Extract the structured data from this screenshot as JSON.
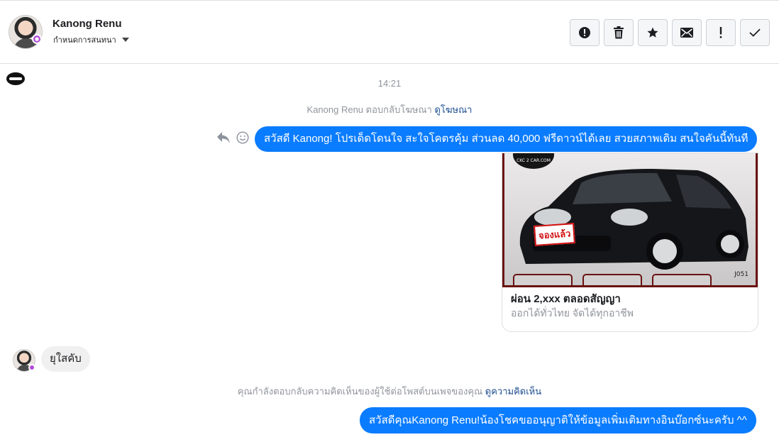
{
  "header": {
    "contact_name": "Kanong Renu",
    "assign_label": "กำหนดการสนทนา",
    "actions": [
      {
        "name": "spam-button",
        "icon": "exclamation-circle-icon"
      },
      {
        "name": "delete-button",
        "icon": "trash-icon"
      },
      {
        "name": "star-button",
        "icon": "star-icon"
      },
      {
        "name": "mark-unread-button",
        "icon": "envelope-icon"
      },
      {
        "name": "follow-up-button",
        "icon": "exclamation-icon"
      },
      {
        "name": "mark-done-button",
        "icon": "check-icon"
      }
    ]
  },
  "thread": {
    "timestamp": "14:21",
    "ad_reply_notice": {
      "text": "Kanong Renu ตอบกลับโฆษณา",
      "link": "ดูโฆษณา"
    },
    "outgoing_1": "สวัสดี Kanong! โปรเด็ดโดนใจ สะใจโคตรคุ้ม ส่วนลด 40,000 ฟรีดาวน์ได้เลย สวยสภาพเดิม สนใจคันนี้ทันที",
    "ad_card": {
      "logo_text": "CKC 2 CAR.COM",
      "stamp_text": "จองแล้ว",
      "plate_code": "J051",
      "title": "ผ่อน 2,xxx ตลอดสัญญา",
      "subtitle": "ออกได้ทั่วไทย จัดได้ทุกอาชีพ"
    },
    "incoming_1": "ยุใสคับ",
    "comment_reply_notice": {
      "text": "คุณกำลังตอบกลับความคิดเห็นของผู้ใช้ต่อโพสต์บนเพจของคุณ",
      "link": "ดูความคิดเห็น"
    },
    "outgoing_2": "สวัสดีคุณKanong Renu!น้องโชคขออนุญาติให้ข้อมูลเพิ่มเติมทางอินบ๊อกซ์นะครับ ^^"
  },
  "colors": {
    "accent": "#0a7cff",
    "link": "#1c4e8f",
    "muted": "#90949c",
    "incoming_bg": "#f1f0f0"
  }
}
